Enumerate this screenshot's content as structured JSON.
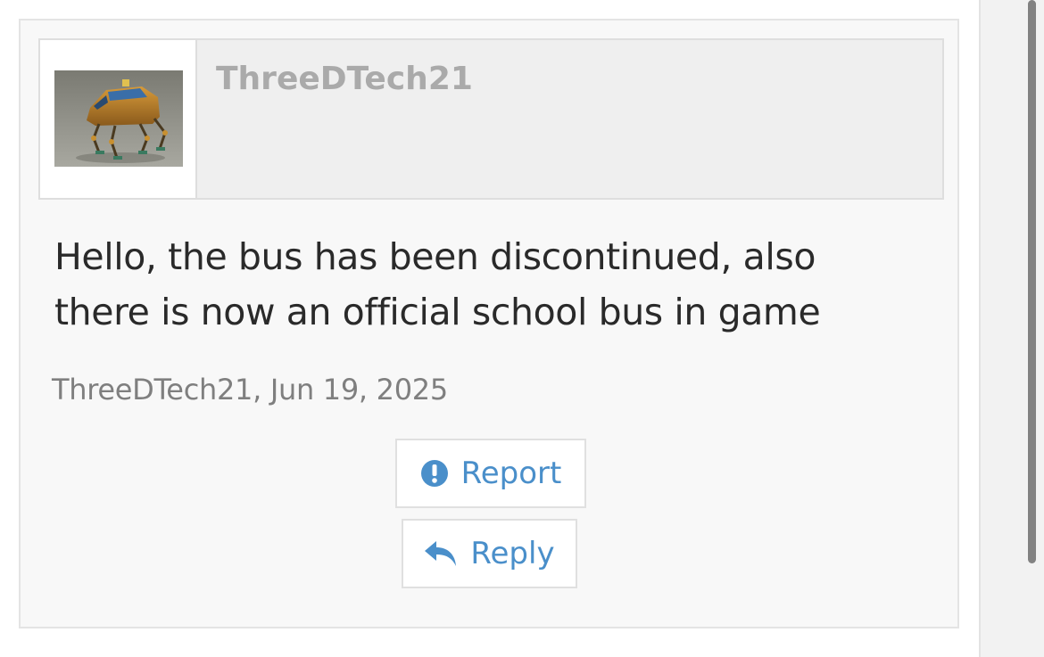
{
  "post": {
    "author": "ThreeDTech21",
    "message": "Hello, the bus has been discontinued, also there is now an official school bus in game",
    "meta": "ThreeDTech21, Jun 19, 2025"
  },
  "actions": {
    "report_label": "Report",
    "reply_label": "Reply"
  },
  "icons": {
    "report": "exclamation-circle-icon",
    "reply": "reply-arrow-icon"
  },
  "colors": {
    "accent": "#4a8fca",
    "username": "#aaaaaa",
    "text": "#2a2a2a",
    "meta": "#7f7f7f"
  }
}
